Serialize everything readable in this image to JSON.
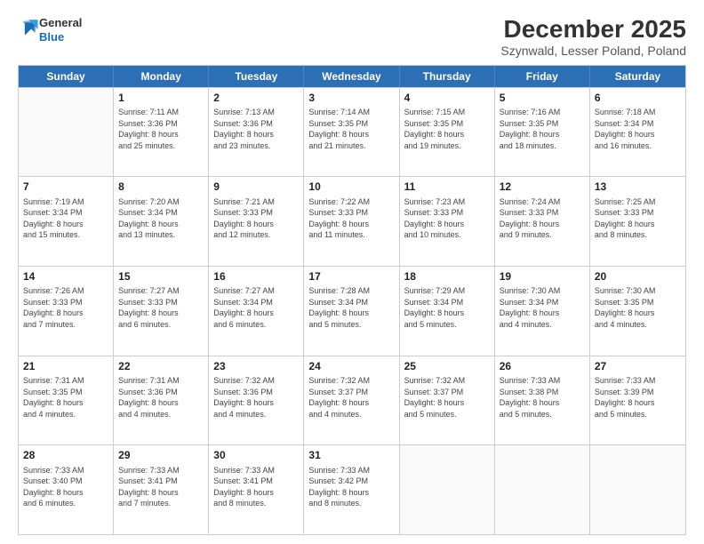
{
  "logo": {
    "line1": "General",
    "line2": "Blue"
  },
  "title": "December 2025",
  "subtitle": "Szynwald, Lesser Poland, Poland",
  "calendar": {
    "headers": [
      "Sunday",
      "Monday",
      "Tuesday",
      "Wednesday",
      "Thursday",
      "Friday",
      "Saturday"
    ],
    "rows": [
      [
        {
          "day": "",
          "empty": true,
          "text": ""
        },
        {
          "day": "1",
          "text": "Sunrise: 7:11 AM\nSunset: 3:36 PM\nDaylight: 8 hours\nand 25 minutes."
        },
        {
          "day": "2",
          "text": "Sunrise: 7:13 AM\nSunset: 3:36 PM\nDaylight: 8 hours\nand 23 minutes."
        },
        {
          "day": "3",
          "text": "Sunrise: 7:14 AM\nSunset: 3:35 PM\nDaylight: 8 hours\nand 21 minutes."
        },
        {
          "day": "4",
          "text": "Sunrise: 7:15 AM\nSunset: 3:35 PM\nDaylight: 8 hours\nand 19 minutes."
        },
        {
          "day": "5",
          "text": "Sunrise: 7:16 AM\nSunset: 3:35 PM\nDaylight: 8 hours\nand 18 minutes."
        },
        {
          "day": "6",
          "text": "Sunrise: 7:18 AM\nSunset: 3:34 PM\nDaylight: 8 hours\nand 16 minutes."
        }
      ],
      [
        {
          "day": "7",
          "text": "Sunrise: 7:19 AM\nSunset: 3:34 PM\nDaylight: 8 hours\nand 15 minutes."
        },
        {
          "day": "8",
          "text": "Sunrise: 7:20 AM\nSunset: 3:34 PM\nDaylight: 8 hours\nand 13 minutes."
        },
        {
          "day": "9",
          "text": "Sunrise: 7:21 AM\nSunset: 3:33 PM\nDaylight: 8 hours\nand 12 minutes."
        },
        {
          "day": "10",
          "text": "Sunrise: 7:22 AM\nSunset: 3:33 PM\nDaylight: 8 hours\nand 11 minutes."
        },
        {
          "day": "11",
          "text": "Sunrise: 7:23 AM\nSunset: 3:33 PM\nDaylight: 8 hours\nand 10 minutes."
        },
        {
          "day": "12",
          "text": "Sunrise: 7:24 AM\nSunset: 3:33 PM\nDaylight: 8 hours\nand 9 minutes."
        },
        {
          "day": "13",
          "text": "Sunrise: 7:25 AM\nSunset: 3:33 PM\nDaylight: 8 hours\nand 8 minutes."
        }
      ],
      [
        {
          "day": "14",
          "text": "Sunrise: 7:26 AM\nSunset: 3:33 PM\nDaylight: 8 hours\nand 7 minutes."
        },
        {
          "day": "15",
          "text": "Sunrise: 7:27 AM\nSunset: 3:33 PM\nDaylight: 8 hours\nand 6 minutes."
        },
        {
          "day": "16",
          "text": "Sunrise: 7:27 AM\nSunset: 3:34 PM\nDaylight: 8 hours\nand 6 minutes."
        },
        {
          "day": "17",
          "text": "Sunrise: 7:28 AM\nSunset: 3:34 PM\nDaylight: 8 hours\nand 5 minutes."
        },
        {
          "day": "18",
          "text": "Sunrise: 7:29 AM\nSunset: 3:34 PM\nDaylight: 8 hours\nand 5 minutes."
        },
        {
          "day": "19",
          "text": "Sunrise: 7:30 AM\nSunset: 3:34 PM\nDaylight: 8 hours\nand 4 minutes."
        },
        {
          "day": "20",
          "text": "Sunrise: 7:30 AM\nSunset: 3:35 PM\nDaylight: 8 hours\nand 4 minutes."
        }
      ],
      [
        {
          "day": "21",
          "text": "Sunrise: 7:31 AM\nSunset: 3:35 PM\nDaylight: 8 hours\nand 4 minutes."
        },
        {
          "day": "22",
          "text": "Sunrise: 7:31 AM\nSunset: 3:36 PM\nDaylight: 8 hours\nand 4 minutes."
        },
        {
          "day": "23",
          "text": "Sunrise: 7:32 AM\nSunset: 3:36 PM\nDaylight: 8 hours\nand 4 minutes."
        },
        {
          "day": "24",
          "text": "Sunrise: 7:32 AM\nSunset: 3:37 PM\nDaylight: 8 hours\nand 4 minutes."
        },
        {
          "day": "25",
          "text": "Sunrise: 7:32 AM\nSunset: 3:37 PM\nDaylight: 8 hours\nand 5 minutes."
        },
        {
          "day": "26",
          "text": "Sunrise: 7:33 AM\nSunset: 3:38 PM\nDaylight: 8 hours\nand 5 minutes."
        },
        {
          "day": "27",
          "text": "Sunrise: 7:33 AM\nSunset: 3:39 PM\nDaylight: 8 hours\nand 5 minutes."
        }
      ],
      [
        {
          "day": "28",
          "text": "Sunrise: 7:33 AM\nSunset: 3:40 PM\nDaylight: 8 hours\nand 6 minutes."
        },
        {
          "day": "29",
          "text": "Sunrise: 7:33 AM\nSunset: 3:41 PM\nDaylight: 8 hours\nand 7 minutes."
        },
        {
          "day": "30",
          "text": "Sunrise: 7:33 AM\nSunset: 3:41 PM\nDaylight: 8 hours\nand 8 minutes."
        },
        {
          "day": "31",
          "text": "Sunrise: 7:33 AM\nSunset: 3:42 PM\nDaylight: 8 hours\nand 8 minutes."
        },
        {
          "day": "",
          "empty": true,
          "text": ""
        },
        {
          "day": "",
          "empty": true,
          "text": ""
        },
        {
          "day": "",
          "empty": true,
          "text": ""
        }
      ]
    ]
  }
}
